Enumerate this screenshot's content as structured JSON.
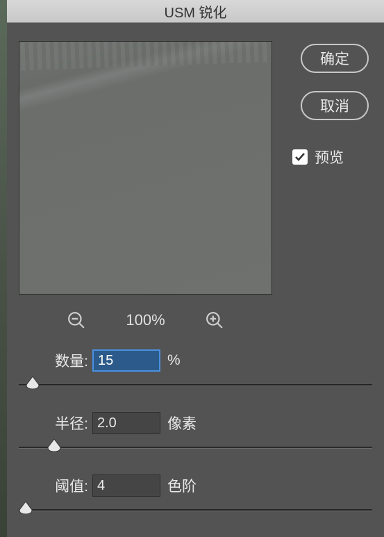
{
  "title": "USM 锐化",
  "buttons": {
    "ok": "确定",
    "cancel": "取消"
  },
  "preview_checkbox": {
    "label": "预览",
    "checked": true
  },
  "zoom": {
    "level": "100%"
  },
  "params": {
    "amount": {
      "label": "数量:",
      "value": "15",
      "unit": "%",
      "thumb_pct": 4
    },
    "radius": {
      "label": "半径:",
      "value": "2.0",
      "unit": "像素",
      "thumb_pct": 10
    },
    "threshold": {
      "label": "阈值:",
      "value": "4",
      "unit": "色阶",
      "thumb_pct": 2
    }
  }
}
